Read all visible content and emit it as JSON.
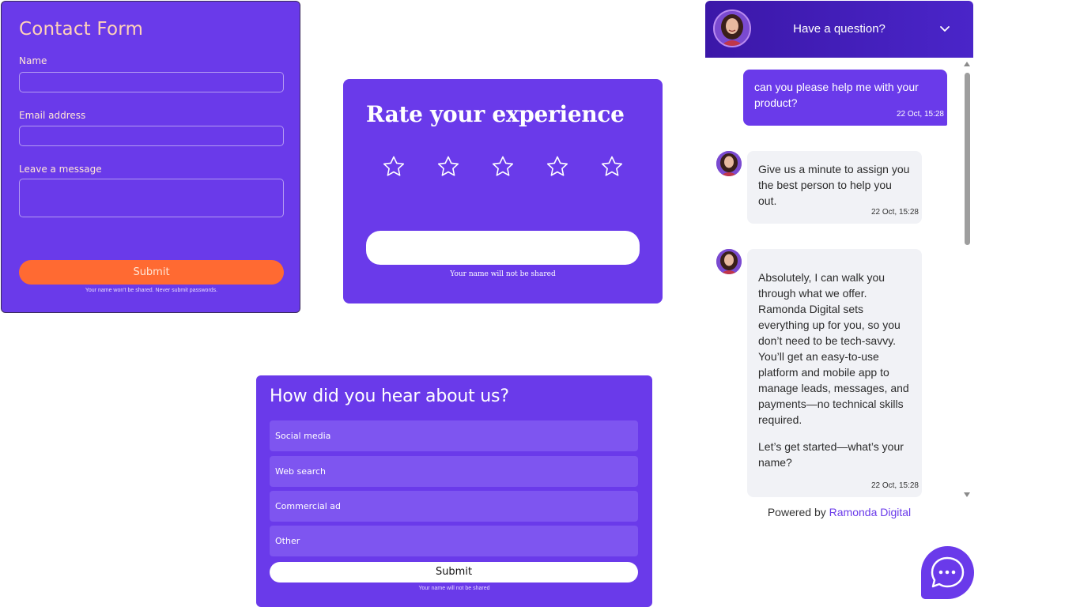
{
  "contact_form": {
    "title": "Contact Form",
    "name_label": "Name",
    "email_label": "Email address",
    "message_label": "Leave a message",
    "submit_label": "Submit",
    "note": "Your name won't be shared. Never submit passwords."
  },
  "rating": {
    "title": "Rate your experience",
    "stars": 5,
    "selected": 0,
    "note": "Your name will not be shared"
  },
  "survey": {
    "title": "How did you hear about us?",
    "options": [
      "Social media",
      "Web search",
      "Commercial ad",
      "Other"
    ],
    "submit_label": "Submit",
    "note": "Your name will not be shared"
  },
  "chat": {
    "header_title": "Have a question?",
    "messages": [
      {
        "from": "user",
        "text": "can you please help me with your product?",
        "time": "22 Oct, 15:28"
      },
      {
        "from": "bot",
        "text": "Give us a minute to assign you the best person to help you out.",
        "time": "22 Oct, 15:28"
      },
      {
        "from": "bot",
        "paragraphs": [
          "Absolutely, I can walk you through what we offer. Ramonda Digital sets everything up for you, so you don’t need to be tech-savvy. You’ll get an easy-to-use platform and mobile app to manage leads, messages, and payments—no technical skills required.",
          "Let’s get started—what’s your name?"
        ],
        "time": "22 Oct, 15:28"
      }
    ],
    "powered_prefix": "Powered by",
    "powered_brand": "Ramonda Digital"
  },
  "colors": {
    "brand_purple": "#6a3aea",
    "header_purple": "#3b17a8",
    "accent_orange": "#ff6a32"
  },
  "icons": {
    "star": "star-outline-icon",
    "chevron": "chevron-down-icon",
    "launcher": "chat-bubble-dots-icon"
  }
}
